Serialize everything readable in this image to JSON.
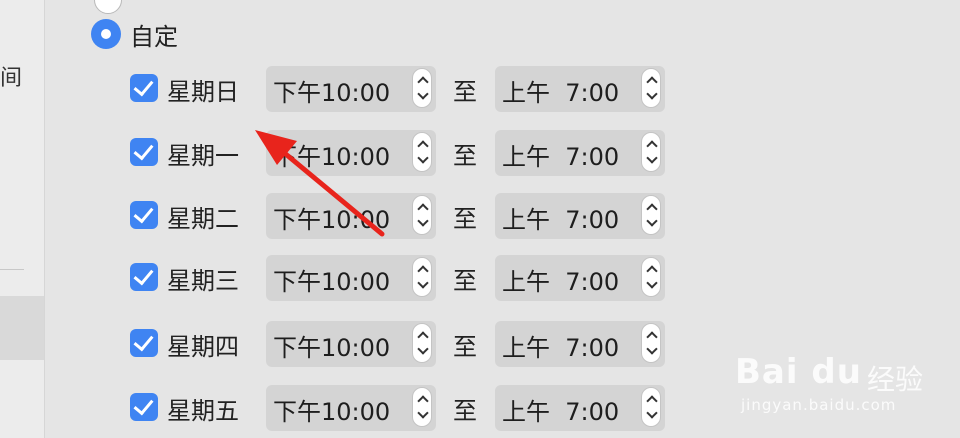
{
  "sidebar": {
    "fragment_text": "间"
  },
  "schedule": {
    "custom_label": "自定",
    "to_label": "至",
    "days": [
      {
        "label": "星期日",
        "start": "下午10:00",
        "end": "上午  7:00",
        "checked": true
      },
      {
        "label": "星期一",
        "start": "下午10:00",
        "end": "上午  7:00",
        "checked": true
      },
      {
        "label": "星期二",
        "start": "下午10:00",
        "end": "上午  7:00",
        "checked": true
      },
      {
        "label": "星期三",
        "start": "下午10:00",
        "end": "上午  7:00",
        "checked": true
      },
      {
        "label": "星期四",
        "start": "下午10:00",
        "end": "上午  7:00",
        "checked": true
      },
      {
        "label": "星期五",
        "start": "下午10:00",
        "end": "上午  7:00",
        "checked": true
      }
    ]
  },
  "colors": {
    "accent": "#3f84f2",
    "annotation_arrow": "#e8241c"
  },
  "watermark": {
    "logo_text": "Bai du",
    "cn_text": "经验",
    "url_text": "jingyan.baidu.com"
  }
}
